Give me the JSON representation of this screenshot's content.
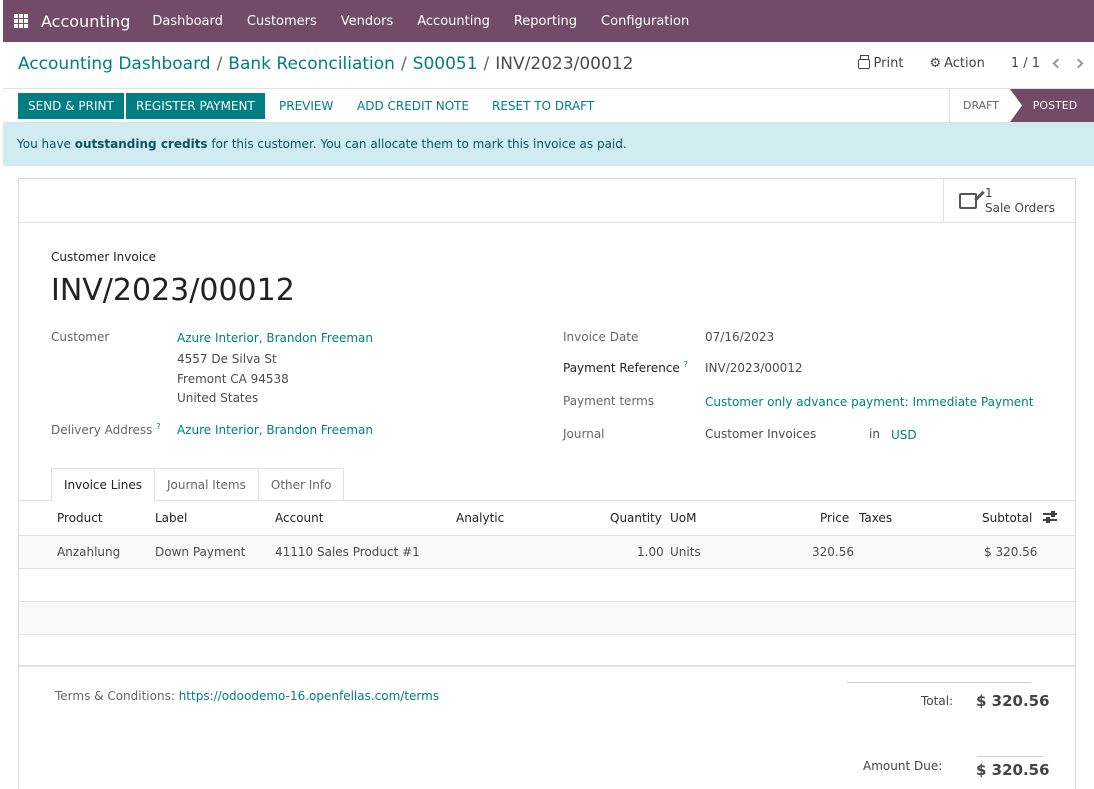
{
  "nav": {
    "app_name": "Accounting",
    "menus": [
      "Dashboard",
      "Customers",
      "Vendors",
      "Accounting",
      "Reporting",
      "Configuration"
    ]
  },
  "breadcrumb": {
    "items": [
      "Accounting Dashboard",
      "Bank Reconciliation",
      "S00051"
    ],
    "current": "INV/2023/00012"
  },
  "control": {
    "print_label": "Print",
    "action_label": "Action",
    "pager": "1 / 1"
  },
  "statusbar": {
    "send_print": "SEND & PRINT",
    "register_payment": "REGISTER PAYMENT",
    "preview": "PREVIEW",
    "add_credit_note": "ADD CREDIT NOTE",
    "reset_to_draft": "RESET TO DRAFT",
    "stage_draft": "DRAFT",
    "stage_posted": "POSTED"
  },
  "alert": {
    "prefix": "You have ",
    "bold": "outstanding credits",
    "suffix": " for this customer. You can allocate them to mark this invoice as paid."
  },
  "smart_button": {
    "count": "1",
    "label": "Sale Orders"
  },
  "invoice": {
    "type_label": "Customer Invoice",
    "number": "INV/2023/00012",
    "customer_label": "Customer",
    "customer_name": "Azure Interior, Brandon Freeman",
    "address_line1": "4557 De Silva St",
    "address_line2": "Fremont CA 94538",
    "address_line3": "United States",
    "delivery_label": "Delivery Address",
    "delivery_value": "Azure Interior, Brandon Freeman",
    "invoice_date_label": "Invoice Date",
    "invoice_date": "07/16/2023",
    "payment_ref_label": "Payment Reference",
    "payment_ref": "INV/2023/00012",
    "payment_terms_label": "Payment terms",
    "payment_terms": "Customer only advance payment: Immediate Payment",
    "journal_label": "Journal",
    "journal": "Customer Invoices",
    "in_label": "in",
    "currency": "USD",
    "help_mark": "?"
  },
  "tabs": [
    "Invoice Lines",
    "Journal Items",
    "Other Info"
  ],
  "table": {
    "headers": {
      "product": "Product",
      "label": "Label",
      "account": "Account",
      "analytic": "Analytic",
      "quantity": "Quantity",
      "uom": "UoM",
      "price": "Price",
      "taxes": "Taxes",
      "subtotal": "Subtotal"
    },
    "rows": [
      {
        "product": "Anzahlung",
        "label": "Down Payment",
        "account": "41110 Sales Product #1",
        "analytic": "",
        "quantity": "1.00",
        "uom": "Units",
        "price": "320.56",
        "taxes": "",
        "subtotal": "$ 320.56"
      }
    ]
  },
  "footer": {
    "terms_label": "Terms & Conditions: ",
    "terms_link": "https://odoodemo-16.openfellas.com/terms",
    "total_label": "Total:",
    "total_value": "$ 320.56",
    "amount_due_label": "Amount Due:",
    "amount_due_value": "$ 320.56"
  },
  "colors": {
    "brand": "#714b67",
    "primary": "#017e84",
    "alert_bg": "#d1ecf1"
  }
}
